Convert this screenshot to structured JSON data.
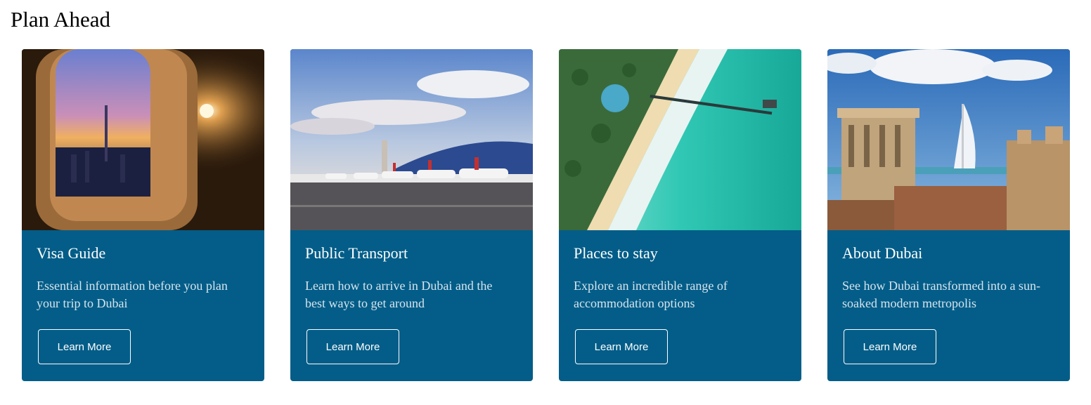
{
  "section": {
    "title": "Plan Ahead"
  },
  "colors": {
    "card_bg": "#035d88",
    "title": "#ffffff",
    "desc": "#d6e4ee"
  },
  "cards": [
    {
      "image": "airplane-window-dubai-skyline",
      "title": "Visa Guide",
      "description": "Essential information before you plan your trip to Dubai",
      "button": "Learn More"
    },
    {
      "image": "airport-emirates-planes",
      "title": "Public Transport",
      "description": "Learn how to arrive in Dubai and the best ways to get around",
      "button": "Learn More"
    },
    {
      "image": "aerial-beach-pier",
      "title": "Places to stay",
      "description": "Explore an incredible range of accommodation options",
      "button": "Learn More"
    },
    {
      "image": "burj-al-arab-wind-tower",
      "title": "About Dubai",
      "description": "See how Dubai transformed into a sun-soaked modern metropolis",
      "button": "Learn More"
    }
  ]
}
